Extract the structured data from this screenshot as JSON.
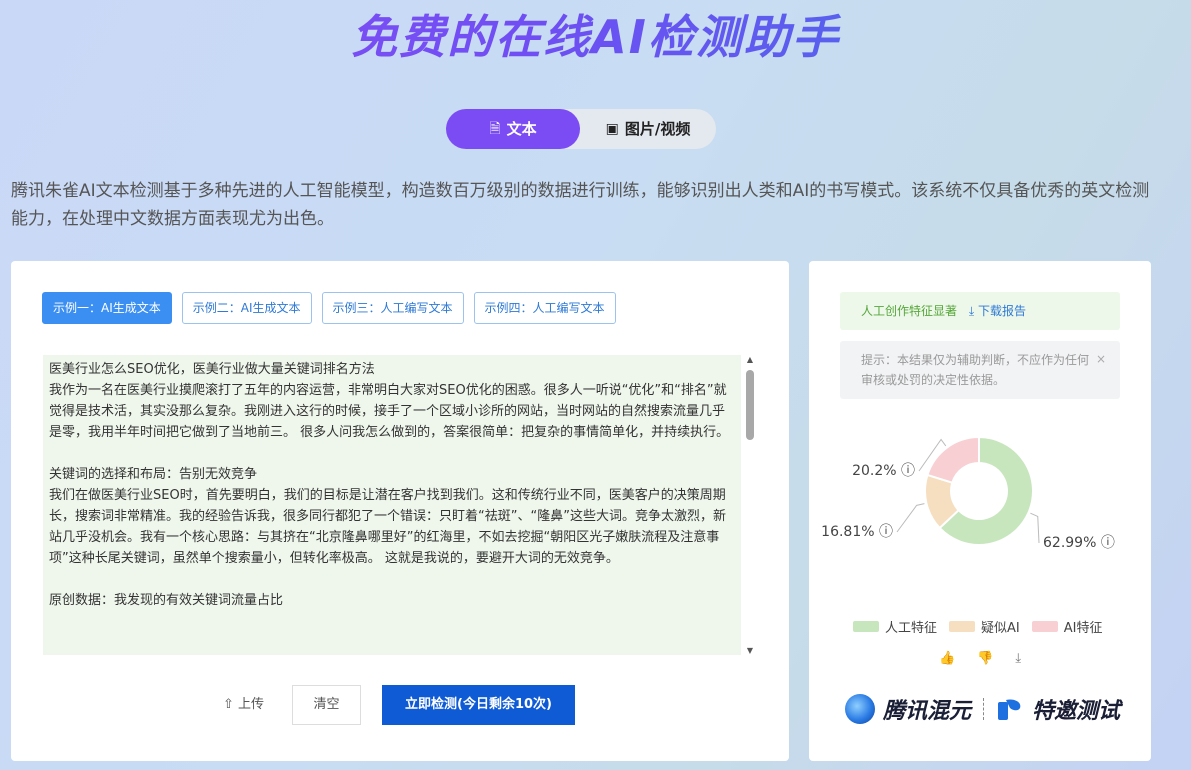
{
  "hero": {
    "title": "免费的在线AI检测助手"
  },
  "mode_tabs": [
    {
      "label": "文本",
      "icon": "document-icon"
    },
    {
      "label": "图片/视频",
      "icon": "image-icon"
    }
  ],
  "intro": "腾讯朱雀AI文本检测基于多种先进的人工智能模型，构造数百万级别的数据进行训练，能够识别出人类和AI的书写模式。该系统不仅具备优秀的英文检测能力，在处理中文数据方面表现尤为出色。",
  "examples": [
    {
      "label": "示例一：AI生成文本"
    },
    {
      "label": "示例二：AI生成文本"
    },
    {
      "label": "示例三：人工编写文本"
    },
    {
      "label": "示例四：人工编写文本"
    }
  ],
  "textbox": {
    "paragraphs": [
      "医美行业怎么SEO优化，医美行业做大量关键词排名方法",
      "我作为一名在医美行业摸爬滚打了五年的内容运营，非常明白大家对SEO优化的困惑。很多人一听说“优化”和“排名”就觉得是技术活，其实没那么复杂。我刚进入这行的时候，接手了一个区域小诊所的网站，当时网站的自然搜索流量几乎是零，我用半年时间把它做到了当地前三。 很多人问我怎么做到的，答案很简单：把复杂的事情简单化，并持续执行。",
      "",
      "关键词的选择和布局：告别无效竞争",
      "我们在做医美行业SEO时，首先要明白，我们的目标是让潜在客户找到我们。这和传统行业不同，医美客户的决策周期长，搜索词非常精准。我的经验告诉我，很多同行都犯了一个错误：只盯着“祛斑”、“隆鼻”这些大词。竞争太激烈，新站几乎没机会。我有一个核心思路：与其挤在“北京隆鼻哪里好”的红海里，不如去挖掘“朝阳区光子嫩肤流程及注意事项”这种长尾关键词，虽然单个搜索量小，但转化率极高。 这就是我说的，要避开大词的无效竞争。",
      "",
      "原创数据：我发现的有效关键词流量占比"
    ]
  },
  "actions": {
    "upload": "上传",
    "clear": "清空",
    "detect": "立即检测(今日剩余10次)"
  },
  "result": {
    "status": "人工创作特征显著",
    "download": "下载报告",
    "hint": "提示：本结果仅为辅助判断，不应作为任何审核或处罚的决定性依据。",
    "close": "×"
  },
  "chart_data": {
    "type": "pie",
    "categories": [
      "人工特征",
      "疑似AI",
      "AI特征"
    ],
    "values": [
      62.99,
      16.81,
      20.2
    ],
    "labels": [
      "62.99%",
      "16.81%",
      "20.2%"
    ],
    "colors": [
      "#c8e6bd",
      "#f6dfc1",
      "#f8cfd2"
    ],
    "legend_position": "bottom"
  },
  "feedback": [
    "thumbs-up-icon",
    "thumbs-down-icon",
    "download-icon"
  ],
  "brand": {
    "left": "腾讯混元",
    "right": "特邀测试"
  }
}
